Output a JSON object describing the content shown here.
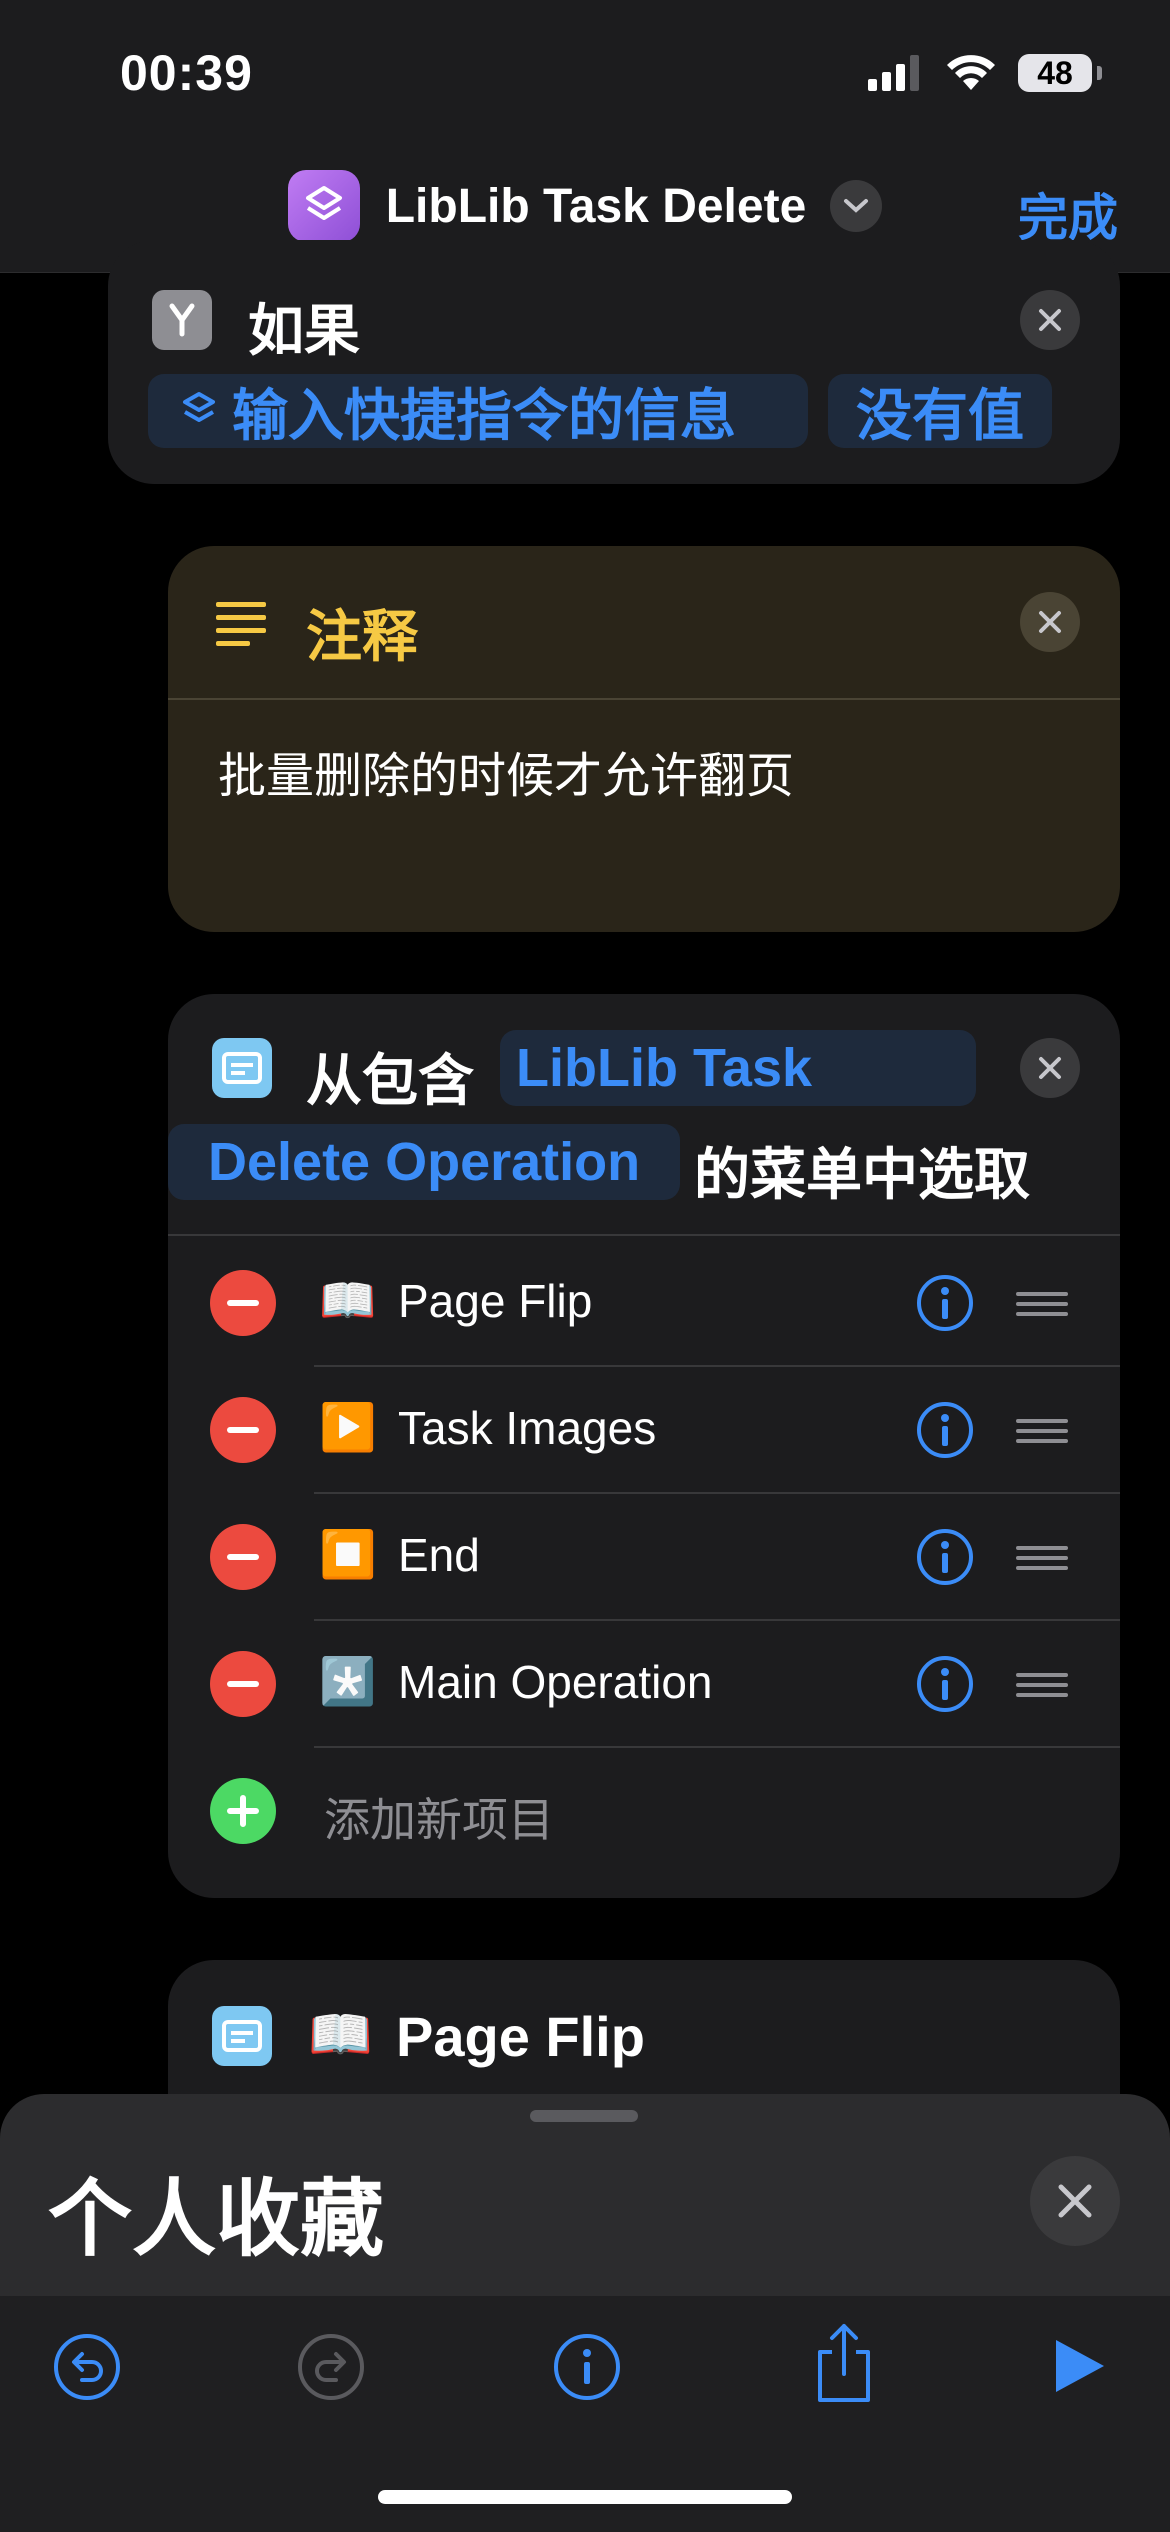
{
  "status": {
    "time": "00:39",
    "battery": "48"
  },
  "nav": {
    "title": "LibLib Task Delete",
    "done_label": "完成"
  },
  "if_block": {
    "label": "如果",
    "variable_label": "输入快捷指令的信息",
    "condition_label": "没有值"
  },
  "comment": {
    "label": "注释",
    "text": "批量删除的时候才允许翻页"
  },
  "menu": {
    "prefix": "从包含",
    "prompt_line1": "LibLib Task",
    "prompt_line2": "Delete Operation",
    "suffix": "的菜单中选取",
    "items": [
      {
        "emoji": "📖",
        "label": "Page Flip"
      },
      {
        "emoji": "▶️",
        "label": "Task Images"
      },
      {
        "emoji": "⏹️",
        "label": "End"
      },
      {
        "emoji": "*️⃣",
        "label": "Main Operation"
      }
    ],
    "add_label": "添加新项目"
  },
  "menu_case": {
    "emoji": "📖",
    "label": "Page Flip"
  },
  "sheet": {
    "title": "个人收藏"
  },
  "colors": {
    "accent": "#3b8cf7",
    "comment_label": "#f6c944",
    "delete": "#ec4a3f",
    "add": "#4cd964"
  },
  "icons": [
    "signal-icon",
    "wifi-icon",
    "battery-icon",
    "shortcuts-app-icon",
    "chevron-down-icon",
    "if-branch-icon",
    "variable-icon",
    "close-icon",
    "text-lines-icon",
    "menu-icon",
    "minus-icon",
    "info-icon",
    "grip-icon",
    "plus-icon",
    "undo-icon",
    "redo-icon",
    "share-icon",
    "play-icon"
  ]
}
